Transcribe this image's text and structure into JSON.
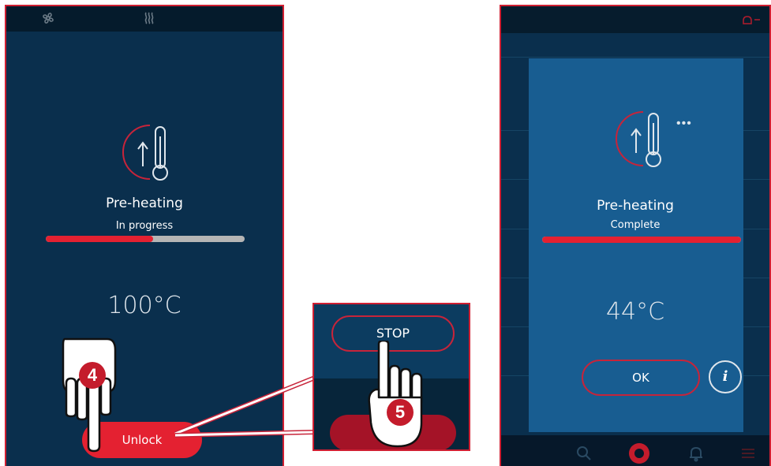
{
  "left_screen": {
    "title": "Pre-heating",
    "status": "In progress",
    "progress": 0.54,
    "temperature": "100°C",
    "unlock_label": "Unlock"
  },
  "zoom": {
    "stop_label": "STOP"
  },
  "right_screen": {
    "title": "Pre-heating",
    "status": "Complete",
    "progress": 1.0,
    "temperature": "44°C",
    "ok_label": "OK",
    "info_label": "i",
    "more_label": "•••"
  },
  "steps": {
    "step_a": "4",
    "step_b": "5"
  },
  "colors": {
    "accent": "#e42131",
    "screen_bg": "#0a2f4d",
    "dialog_bg": "#185d91",
    "progress_track": "#b5b5b5"
  },
  "icons": [
    "fan-icon",
    "heat-waves-icon",
    "thermometer-up-icon",
    "search-icon",
    "record-icon",
    "bell-icon",
    "menu-icon",
    "pointing-hand-icon"
  ]
}
